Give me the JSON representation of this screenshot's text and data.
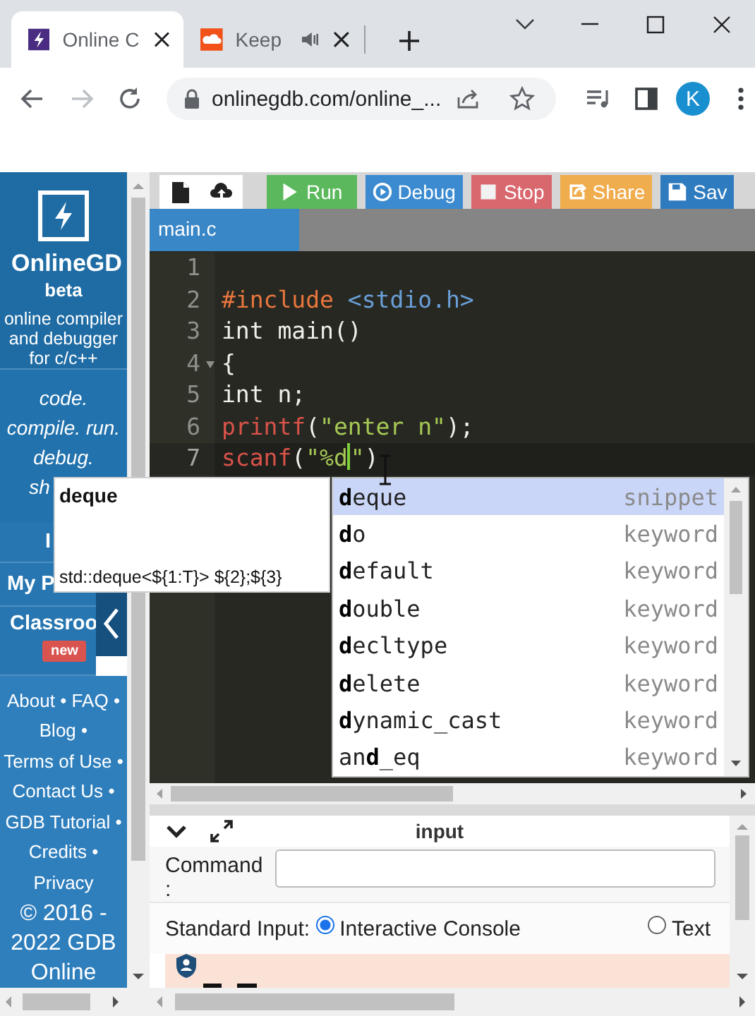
{
  "browser": {
    "tabs": [
      {
        "title": "Online C",
        "selected": true,
        "audio": false
      },
      {
        "title": "Keep",
        "selected": false,
        "audio": true
      }
    ],
    "address": "onlinegdb.com/online_...",
    "profile": "K"
  },
  "sidebar": {
    "brand": "OnlineGD",
    "edition": "beta",
    "tagline": "online compiler and debugger for c/c++",
    "motto": [
      "code.",
      "compile. run.",
      "debug.",
      "sh"
    ],
    "menu": [
      {
        "label": "I"
      },
      {
        "label": "My P"
      },
      {
        "label": "Classroo",
        "badge": "new"
      }
    ],
    "links": [
      "About",
      "FAQ",
      "Blog",
      "Terms of Use",
      "Contact Us",
      "GDB Tutorial",
      "Credits",
      "Privacy"
    ],
    "link_separator": "•",
    "copyright": "© 2016 - 2022 GDB Online"
  },
  "toolbar": [
    {
      "kind": "new-file"
    },
    {
      "kind": "upload"
    },
    {
      "kind": "run",
      "label": "Run",
      "color": "#5cb85c"
    },
    {
      "kind": "debug",
      "label": "Debug",
      "color": "#3c8bd0"
    },
    {
      "kind": "stop",
      "label": "Stop",
      "color": "#d9676e"
    },
    {
      "kind": "share",
      "label": "Share",
      "color": "#f0ad4e"
    },
    {
      "kind": "save",
      "label": "Sav",
      "color": "#2f7bbf"
    }
  ],
  "editor": {
    "file_tabs": [
      {
        "label": "main.c",
        "selected": true
      }
    ],
    "lines": [
      {
        "number": "1",
        "foldable": false,
        "active": false
      },
      {
        "number": "2",
        "foldable": false,
        "active": false,
        "tokens": [
          {
            "kind": "directive",
            "text": "#include "
          },
          {
            "kind": "header",
            "text": "<stdio.h>"
          }
        ]
      },
      {
        "number": "3",
        "foldable": false,
        "active": false,
        "tokens": [
          {
            "kind": "plain",
            "text": "int main()"
          }
        ]
      },
      {
        "number": "4",
        "foldable": true,
        "active": false,
        "tokens": [
          {
            "kind": "plain",
            "text": "{"
          }
        ]
      },
      {
        "number": "5",
        "foldable": false,
        "active": false,
        "tokens": [
          {
            "kind": "plain",
            "text": "int n;"
          }
        ]
      },
      {
        "number": "6",
        "foldable": false,
        "active": false,
        "tokens": [
          {
            "kind": "function",
            "text": "printf"
          },
          {
            "kind": "plain",
            "text": "("
          },
          {
            "kind": "string",
            "text": "\"enter n\""
          },
          {
            "kind": "plain",
            "text": ");"
          }
        ]
      },
      {
        "number": "7",
        "foldable": false,
        "active": true,
        "tokens": [
          {
            "kind": "function",
            "text": "scanf"
          },
          {
            "kind": "plain",
            "text": "("
          },
          {
            "kind": "string",
            "text": "\"%d"
          },
          {
            "kind": "cursor"
          },
          {
            "kind": "string",
            "text": "\""
          },
          {
            "kind": "plain",
            "text": ")"
          }
        ]
      }
    ]
  },
  "doc_tooltip": {
    "title": "deque",
    "signature": "std::deque<${1:T}> ${2};${3}"
  },
  "completion": {
    "items": [
      {
        "label": "**d**eque",
        "type": "snippet",
        "selected": true
      },
      {
        "label": "**d**o",
        "type": "keyword",
        "selected": false
      },
      {
        "label": "**d**efault",
        "type": "keyword",
        "selected": false
      },
      {
        "label": "**d**ouble",
        "type": "keyword",
        "selected": false
      },
      {
        "label": "**d**ecltype",
        "type": "keyword",
        "selected": false
      },
      {
        "label": "**d**elete",
        "type": "keyword",
        "selected": false
      },
      {
        "label": "**d**ynamic_cast",
        "type": "keyword",
        "selected": false
      },
      {
        "label": "an**d**_eq",
        "type": "keyword",
        "selected": false
      }
    ]
  },
  "input_panel": {
    "title": "input",
    "command_label": "Command :",
    "stdin_label": "Standard Input:",
    "stdin_options": [
      {
        "label": "Interactive Console",
        "selected": true
      },
      {
        "label": "Text",
        "selected": false
      }
    ]
  }
}
